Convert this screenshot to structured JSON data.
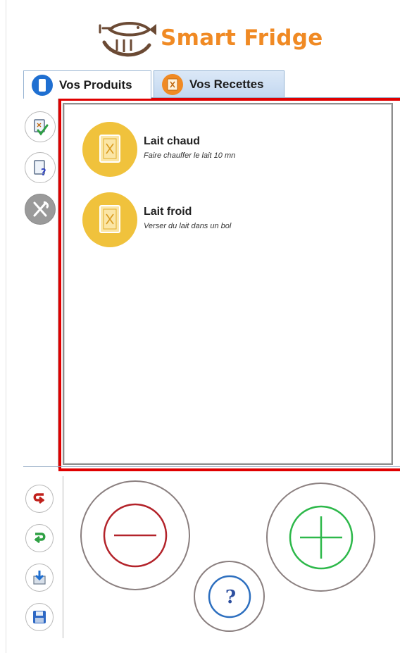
{
  "app": {
    "title": "Smart Fridge"
  },
  "tabs": [
    {
      "label": "Vos Produits",
      "icon": "products-icon",
      "active": true
    },
    {
      "label": "Vos Recettes",
      "icon": "recipe-book-icon",
      "active": false
    }
  ],
  "sidebar": {
    "items": [
      {
        "icon": "validate-recipe-icon"
      },
      {
        "icon": "recipe-help-icon"
      },
      {
        "icon": "cutlery-icon"
      }
    ]
  },
  "recipes": [
    {
      "name": "Lait chaud",
      "description": "Faire chauffer le lait 10 mn"
    },
    {
      "name": "Lait froid",
      "description": "Verser du lait dans un bol"
    }
  ],
  "bottom_toolbar": {
    "items": [
      {
        "icon": "undo-icon"
      },
      {
        "icon": "redo-icon"
      },
      {
        "icon": "import-icon"
      },
      {
        "icon": "save-icon"
      }
    ]
  },
  "actions": {
    "help_label": "?",
    "remove_icon": "minus-icon",
    "add_icon": "plus-icon"
  },
  "colors": {
    "brand_orange": "#f08a24",
    "selection_red": "#e00000",
    "minus_red": "#b3232a",
    "plus_green": "#2db84a",
    "help_blue": "#2d6fbf",
    "recipe_yellow": "#f0c23c"
  }
}
